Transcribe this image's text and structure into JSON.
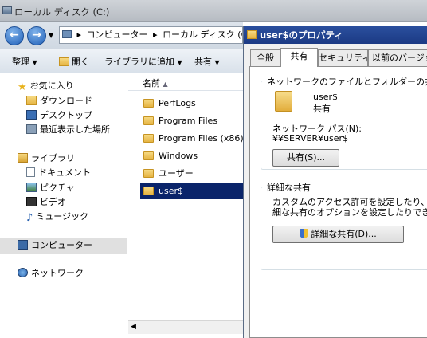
{
  "window": {
    "title": "ローカル ディスク (C:)"
  },
  "address": {
    "crumbs": [
      "コンピューター",
      "ローカル ディスク (C:)"
    ]
  },
  "toolbar": {
    "organize": "整理",
    "open": "開く",
    "add_library": "ライブラリに追加",
    "share": "共有"
  },
  "nav": {
    "favorites": "お気に入り",
    "downloads": "ダウンロード",
    "desktop": "デスクトップ",
    "recent": "最近表示した場所",
    "libraries": "ライブラリ",
    "documents": "ドキュメント",
    "pictures": "ピクチャ",
    "videos": "ビデオ",
    "music": "ミュージック",
    "computer": "コンピューター",
    "network": "ネットワーク"
  },
  "files": {
    "column_name": "名前",
    "items": [
      "PerfLogs",
      "Program Files",
      "Program Files (x86)",
      "Windows",
      "ユーザー",
      "user$"
    ],
    "selected": "user$"
  },
  "dialog": {
    "title": "user$のプロパティ",
    "tabs": [
      "全般",
      "共有",
      "セキュリティ",
      "以前のバージョン"
    ],
    "active_tab": "共有",
    "share_group_label": "ネットワークのファイルとフォルダーの共有",
    "folder_name": "user$",
    "share_status": "共有",
    "network_path_label": "ネットワーク パス(N):",
    "network_path": "¥¥SERVER¥user$",
    "share_button": "共有(S)...",
    "advanced_group_label": "詳細な共有",
    "advanced_desc_1": "カスタムのアクセス許可を設定したり、複数",
    "advanced_desc_2": "細な共有のオプションを設定したりできます",
    "advanced_button": "詳細な共有(D)..."
  }
}
